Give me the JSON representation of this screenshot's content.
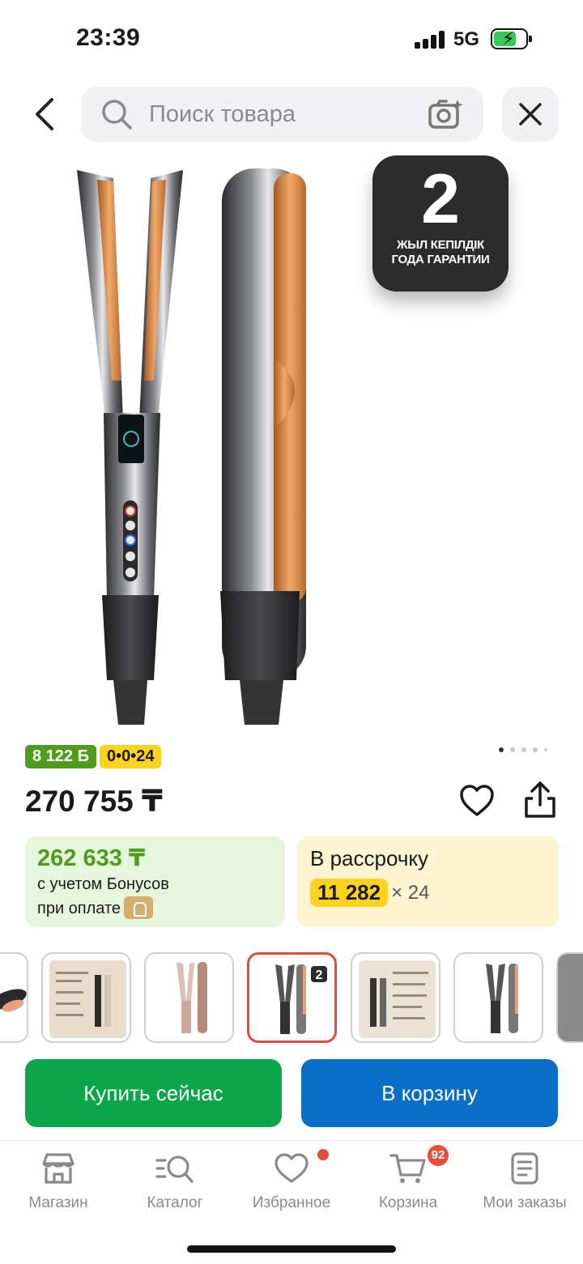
{
  "status_bar": {
    "time": "23:39",
    "network": "5G"
  },
  "search": {
    "placeholder": "Поиск товара"
  },
  "product": {
    "warranty_number": "2",
    "warranty_line1": "ЖЫЛ КЕПІЛДІК",
    "warranty_line2": "ГОДА ГАРАНТИИ",
    "bonus_badge": "8 122 Б",
    "installment_badge": "0•0•24",
    "price": "270 755 ₸",
    "pager_count": 5,
    "pager_active": 0
  },
  "bonus_card": {
    "price": "262 633 ₸",
    "line1": "с учетом Бонусов",
    "line2": "при оплате"
  },
  "installment_card": {
    "title": "В рассрочку",
    "amount": "11 282",
    "multiplier": "× 24"
  },
  "actions": {
    "buy_now": "Купить сейчас",
    "add_to_cart": "В корзину"
  },
  "bottom_nav": {
    "items": [
      {
        "label": "Магазин",
        "icon": "store-icon"
      },
      {
        "label": "Каталог",
        "icon": "catalog-search-icon"
      },
      {
        "label": "Избранное",
        "icon": "heart-icon"
      },
      {
        "label": "Корзина",
        "icon": "cart-icon"
      },
      {
        "label": "Мои заказы",
        "icon": "orders-icon"
      }
    ],
    "cart_count": "92"
  },
  "colors": {
    "green": "#0ba54c",
    "blue": "#0a6ec9",
    "bonus_green": "#4d9c1e",
    "yellow": "#fcd41f",
    "accent_red": "#e04b3c"
  }
}
